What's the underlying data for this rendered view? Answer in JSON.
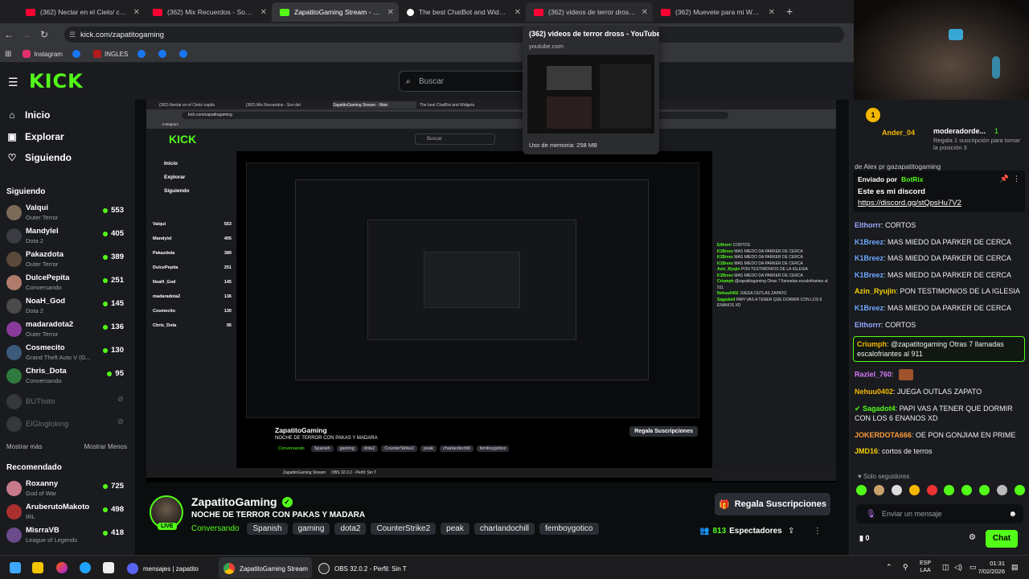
{
  "browser": {
    "tabs": [
      {
        "label": "(362) Nectar en el Cielo/ capítu",
        "favicon": "youtube-icon"
      },
      {
        "label": "(362) Mix Recuerdos - Son del",
        "favicon": "youtube-icon"
      },
      {
        "label": "ZapatitoGaming Stream - Watc",
        "favicon": "kick-icon"
      },
      {
        "label": "The best ChatBot and Widgets",
        "favicon": "botrix-icon"
      },
      {
        "label": "(362) videos de terror dross - Y",
        "favicon": "youtube-icon"
      },
      {
        "label": "(362) Muevete para mi WOODY",
        "favicon": "youtube-icon"
      }
    ],
    "url": "kick.com/zapatitogaming",
    "bookmarks": [
      "Instagram",
      "INGLES"
    ],
    "tooltip": {
      "title": "(362) videos de terror dross - YouTube",
      "domain": "youtube.com",
      "memory": "Uso de memoria: 258 MB"
    }
  },
  "kick": {
    "logo": "KICK",
    "search_placeholder": "Buscar",
    "nav": {
      "home": "Inicio",
      "explore": "Explorar",
      "following": "Siguiendo"
    },
    "following_title": "Siguiendo",
    "following": [
      {
        "name": "Valqui",
        "category": "Outer Terror",
        "viewers": "553"
      },
      {
        "name": "Mandylel",
        "category": "Dota 2",
        "viewers": "405"
      },
      {
        "name": "Pakazdota",
        "category": "Outer Terror",
        "viewers": "389"
      },
      {
        "name": "DulcePepita",
        "category": "Conversando",
        "viewers": "251"
      },
      {
        "name": "NoaH_God",
        "category": "Dota 2",
        "viewers": "145"
      },
      {
        "name": "madaradota2",
        "category": "Outer Terror",
        "viewers": "136"
      },
      {
        "name": "Cosmecito",
        "category": "Grand Theft Auto V (G...",
        "viewers": "130"
      },
      {
        "name": "Chris_Dota",
        "category": "Conversando",
        "viewers": "95"
      }
    ],
    "offline": [
      "BUTIsito",
      "ElGlogloking"
    ],
    "show_more": "Mostrar más",
    "show_less": "Mostrar Menos",
    "recommended_title": "Recomendado",
    "recommended": [
      {
        "name": "Roxanny",
        "category": "God of War",
        "viewers": "725"
      },
      {
        "name": "AruberutoMakoto",
        "category": "IRL",
        "viewers": "498"
      },
      {
        "name": "MisrraVB",
        "category": "League of Legends",
        "viewers": "418"
      }
    ]
  },
  "stream": {
    "streamer": "ZapatitoGaming",
    "live_label": "LIVE",
    "title": "NOCHE DE TERROR CON PAKAS Y MADARA",
    "category": "Conversando",
    "tags": [
      "Spanish",
      "gaming",
      "dota2",
      "CounterStrike2",
      "peak",
      "charlandochill",
      "femboygotico"
    ],
    "subscribe_button": "Regala Suscripciones",
    "viewers": "813",
    "viewers_label": "Espectadores",
    "nested_taskbar_items": [
      "ZapatitoGaming Stream",
      "OBS 32.0.2 - Perfil: Sin T"
    ]
  },
  "chat": {
    "gift": {
      "user": "Ander_04",
      "mod": "moderadorde...",
      "count": "1",
      "text": "Regala 1 suscripción para tomar la posición 3"
    },
    "previous_line": "de Alex pr gazapatitogaming",
    "pinned": {
      "by_label": "Enviado por",
      "by_user": "BotRix",
      "text": "Este es mi discord",
      "link": "https://discord.gg/stQpsHu7V2"
    },
    "messages": [
      {
        "user": "Elthorrr",
        "text": "CORTOS",
        "color": "#9aa8ff"
      },
      {
        "user": "K1Breez",
        "text": "MAS MIEDO DA PARKER DE CERCA",
        "color": "#6fa9ff"
      },
      {
        "user": "K1Breez",
        "text": "MAS MIEDO DA PARKER DE CERCA",
        "color": "#6fa9ff"
      },
      {
        "user": "K1Breez",
        "text": "MAS MIEDO DA PARKER DE CERCA",
        "color": "#6fa9ff"
      },
      {
        "user": "Azin_Ryujin",
        "text": "PON TESTIMONIOS DE LA IGLESIA",
        "color": "#f5d000"
      },
      {
        "user": "K1Breez",
        "text": "MAS MIEDO DA PARKER DE CERCA",
        "color": "#6fa9ff"
      },
      {
        "user": "Elthorrr",
        "text": "CORTOS",
        "color": "#9aa8ff"
      },
      {
        "user": "Criumph",
        "text": "@zapatitogaming Otras 7 llamadas escalofriantes al 911",
        "color": "#f5b800",
        "highlight": true
      },
      {
        "user": "Raziel_760",
        "text": "",
        "color": "#d97bff",
        "emote": true
      },
      {
        "user": "Nehuu0402",
        "text": "JUEGA OUTLAS ZAPATO",
        "color": "#f5b800"
      },
      {
        "user": "Sagadot4",
        "text": "PAPI VAS A TENER QUE DORMIR CON LOS 6 ENANOS XD",
        "color": "#53fc18"
      },
      {
        "user": "JOKERDOTA666",
        "text": "OE PON GONJIAM EN PRIME",
        "color": "#ff9a3c"
      },
      {
        "user": "JMD16",
        "text": "cortos de terros",
        "color": "#f5d000"
      }
    ],
    "subs_only": "Solo seguidores",
    "input_placeholder": "Enviar un mensaje",
    "points": "0",
    "send_button": "Chat"
  },
  "taskbar": {
    "items": [
      "mensajes | zapatito",
      "ZapatitoGaming Stream",
      "OBS 32.0.2 - Perfil: Sin T"
    ],
    "lang": "ESP",
    "lang2": "LAA",
    "time": "01:31",
    "date": "7/02/2026"
  },
  "colors": {
    "kick_green": "#53fc18",
    "bg": "#0b0e0f",
    "panel": "#191b1f"
  }
}
